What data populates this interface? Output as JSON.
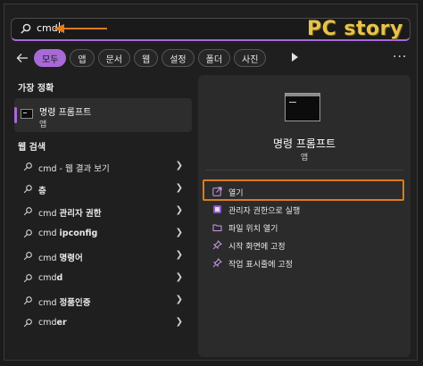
{
  "watermark": "PC story",
  "search": {
    "query": "cmd"
  },
  "tabs": [
    {
      "label": "모두",
      "active": true
    },
    {
      "label": "앱",
      "active": false
    },
    {
      "label": "문서",
      "active": false
    },
    {
      "label": "웹",
      "active": false
    },
    {
      "label": "설정",
      "active": false
    },
    {
      "label": "폴더",
      "active": false
    },
    {
      "label": "사진",
      "active": false
    }
  ],
  "more_label": "···",
  "best_match": {
    "heading": "가장 정확",
    "name": "명령 프롬프트",
    "type": "앱"
  },
  "web": {
    "heading": "웹 검색",
    "items": [
      {
        "prefix": "cmd",
        "bold": "",
        "suffix": " - 웹 결과 보기"
      },
      {
        "prefix": "",
        "bold": "층",
        "suffix": ""
      },
      {
        "prefix": "cmd ",
        "bold": "관리자 권한",
        "suffix": ""
      },
      {
        "prefix": "cmd ",
        "bold": "ipconfig",
        "suffix": ""
      },
      {
        "prefix": "cmd ",
        "bold": "명령어",
        "suffix": ""
      },
      {
        "prefix": "cmd",
        "bold": "d",
        "suffix": ""
      },
      {
        "prefix": "cmd ",
        "bold": "정품인증",
        "suffix": ""
      },
      {
        "prefix": "cmd",
        "bold": "er",
        "suffix": ""
      }
    ]
  },
  "detail": {
    "name": "명령 프롬프트",
    "type": "앱",
    "actions": [
      {
        "label": "열기",
        "icon": "open-icon"
      },
      {
        "label": "관리자 권한으로 실행",
        "icon": "shield-icon"
      },
      {
        "label": "파일 위치 열기",
        "icon": "folder-icon"
      },
      {
        "label": "시작 화면에 고정",
        "icon": "pin-icon"
      },
      {
        "label": "작업 표시줄에 고정",
        "icon": "pin-icon"
      }
    ]
  },
  "colors": {
    "accent": "#a86ad6",
    "highlight": "#e07a1c",
    "watermark": "#e6c34b"
  }
}
